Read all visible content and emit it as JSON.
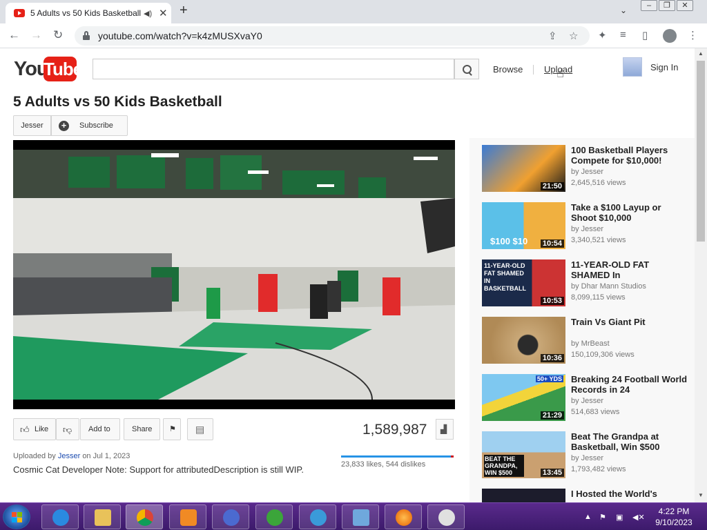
{
  "browser": {
    "tab_title": "5 Adults vs 50 Kids Basketball",
    "new_tab": "+",
    "close_tab": "✕",
    "url": "youtube.com/watch?v=k4zMUSXvaY0"
  },
  "header": {
    "logo_you": "You",
    "logo_tube": "Tube",
    "search_placeholder": "",
    "browse": "Browse",
    "upload": "Upload",
    "sign_in": "Sign In"
  },
  "video": {
    "title": "5 Adults vs 50 Kids Basketball",
    "channel": "Jesser",
    "subscribe": "Subscribe",
    "views": "1,589,987",
    "likes_text": "23,833 likes, 544 dislikes",
    "like_ratio": 0.978,
    "uploaded_prefix": "Uploaded by",
    "uploaded_channel": "Jesser",
    "uploaded_date": "on Jul 1, 2023",
    "description": "Cosmic Cat Developer Note: Support for attributedDescription is still WIP."
  },
  "actions": {
    "like": "Like",
    "add_to": "Add to",
    "share": "Share"
  },
  "related": [
    {
      "title": "100 Basketball Players Compete for $10,000!",
      "by": "by Jesser",
      "views": "2,645,516 views",
      "duration": "21:50",
      "thumb_text": ""
    },
    {
      "title": "Take a $100 Layup or Shoot $10,000",
      "by": "by Jesser",
      "views": "3,340,521 views",
      "duration": "10:54",
      "thumb_text": "$100   $10"
    },
    {
      "title": "11-YEAR-OLD FAT SHAMED In",
      "by": "by Dhar Mann Studios",
      "views": "8,099,115 views",
      "duration": "10:53",
      "thumb_text": "11-YEAR-OLD FAT SHAMED IN BASKETBALL"
    },
    {
      "title": "Train Vs Giant Pit",
      "by": "by MrBeast",
      "views": "150,109,306 views",
      "duration": "10:36",
      "thumb_text": ""
    },
    {
      "title": "Breaking 24 Football World Records in 24",
      "by": "by Jesser",
      "views": "514,683 views",
      "duration": "21:29",
      "thumb_text": "50+ YDS"
    },
    {
      "title": "Beat The Grandpa at Basketball, Win $500",
      "by": "by Jesser",
      "views": "1,793,482 views",
      "duration": "13:45",
      "thumb_text": "BEAT THE GRANDPA, WIN $500"
    },
    {
      "title": "I Hosted the World's",
      "by": "",
      "views": "",
      "duration": "",
      "thumb_text": ""
    }
  ],
  "taskbar": {
    "time": "4:22 PM",
    "date": "9/10/2023"
  },
  "colors": {
    "youtube_red": "#e62117",
    "link_blue": "#1b4bb0",
    "like_blue": "#2793e6",
    "taskbar_purple": "#4a2278"
  }
}
